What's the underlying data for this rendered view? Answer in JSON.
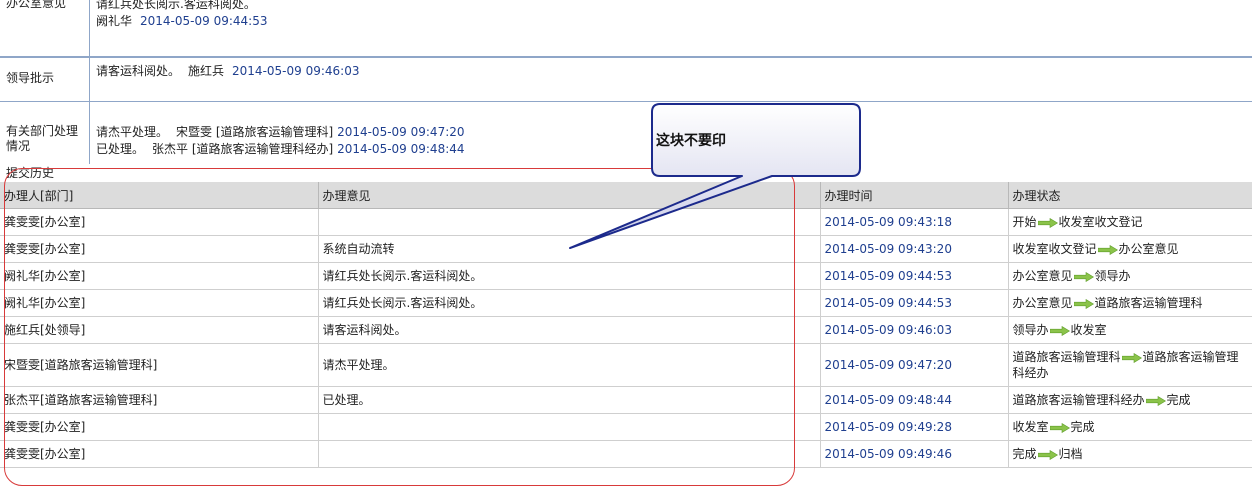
{
  "opinions": {
    "office": {
      "label": "办公室意见",
      "line1": "请红兵处长阅示.客运科阅处。",
      "signer": "阙礼华",
      "time": "2014-05-09 09:44:53"
    },
    "leader": {
      "label": "领导批示",
      "text": "请客运科阅处。",
      "signer": "施红兵",
      "time": "2014-05-09 09:46:03"
    },
    "dept": {
      "label": "有关部门处理情况",
      "rows": [
        {
          "text": "请杰平处理。",
          "signer": "宋暨雯",
          "dept": "[道路旅客运输管理科]",
          "time": "2014-05-09 09:47:20"
        },
        {
          "text": "已处理。",
          "signer": "张杰平",
          "dept": "[道路旅客运输管理科经办]",
          "time": "2014-05-09 09:48:44"
        }
      ]
    }
  },
  "history": {
    "title": "提交历史",
    "headers": [
      "办理人[部门]",
      "办理意见",
      "办理时间",
      "办理状态"
    ],
    "rows": [
      {
        "person": "龚雯雯[办公室]",
        "opinion": "",
        "time": "2014-05-09 09:43:18",
        "from": "开始",
        "to": "收发室收文登记"
      },
      {
        "person": "龚雯雯[办公室]",
        "opinion": "系统自动流转",
        "time": "2014-05-09 09:43:20",
        "from": "收发室收文登记",
        "to": "办公室意见"
      },
      {
        "person": "阙礼华[办公室]",
        "opinion": "请红兵处长阅示.客运科阅处。",
        "time": "2014-05-09 09:44:53",
        "from": "办公室意见",
        "to": "领导办"
      },
      {
        "person": "阙礼华[办公室]",
        "opinion": "请红兵处长阅示.客运科阅处。",
        "time": "2014-05-09 09:44:53",
        "from": "办公室意见",
        "to": "道路旅客运输管理科"
      },
      {
        "person": "施红兵[处领导]",
        "opinion": "请客运科阅处。",
        "time": "2014-05-09 09:46:03",
        "from": "领导办",
        "to": "收发室"
      },
      {
        "person": "宋暨雯[道路旅客运输管理科]",
        "opinion": "请杰平处理。",
        "time": "2014-05-09 09:47:20",
        "from": "道路旅客运输管理科",
        "to": "道路旅客运输管理科经办"
      },
      {
        "person": "张杰平[道路旅客运输管理科]",
        "opinion": "已处理。",
        "time": "2014-05-09 09:48:44",
        "from": "道路旅客运输管理科经办",
        "to": "完成"
      },
      {
        "person": "龚雯雯[办公室]",
        "opinion": "",
        "time": "2014-05-09 09:49:28",
        "from": "收发室",
        "to": "完成"
      },
      {
        "person": "龚雯雯[办公室]",
        "opinion": "",
        "time": "2014-05-09 09:49:46",
        "from": "完成",
        "to": "归档"
      }
    ]
  },
  "annotation": {
    "callout_text": "这块不要印",
    "highlight_color": "#d83a3a",
    "callout_color": "#1c2a8c"
  },
  "colors": {
    "timestamp": "#1f3f8f",
    "arrow": "#8bc34a",
    "header_bg": "#dcdcdc"
  }
}
